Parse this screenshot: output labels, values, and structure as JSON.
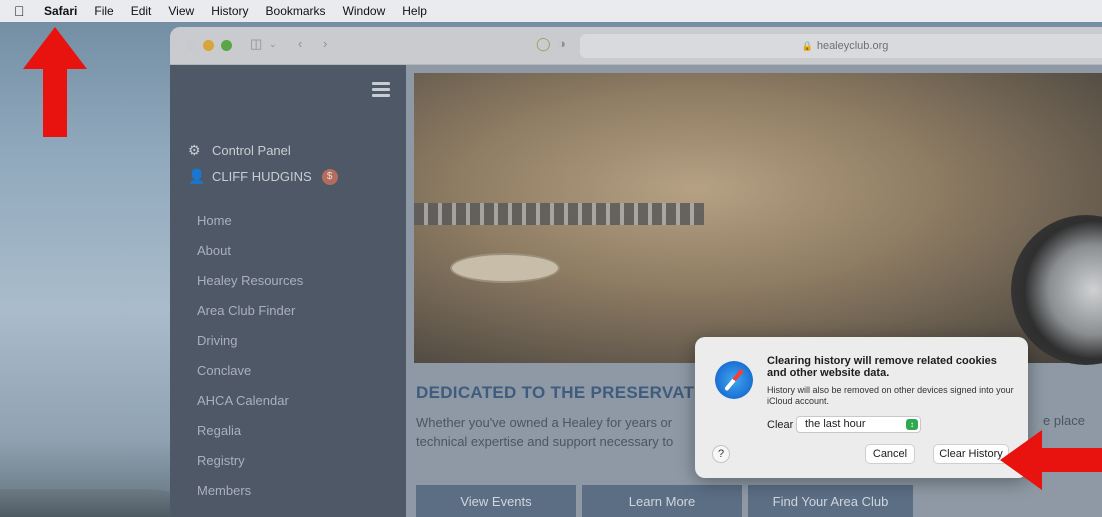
{
  "menubar": {
    "apple_icon": "apple-logo-icon",
    "items": [
      "Safari",
      "File",
      "Edit",
      "View",
      "History",
      "Bookmarks",
      "Window",
      "Help"
    ]
  },
  "browser": {
    "url": "healeyclub.org"
  },
  "sidebar": {
    "control_panel": "Control Panel",
    "user_name": "CLIFF HUDGINS",
    "badge": "$",
    "nav": [
      "Home",
      "About",
      "Healey Resources",
      "Area Club Finder",
      "Driving",
      "Conclave",
      "AHCA Calendar",
      "Regalia",
      "Registry",
      "Members"
    ]
  },
  "main": {
    "headline": "DEDICATED TO THE PRESERVATION AND EN",
    "paragraph": "Whether you've owned a Healey for years or technical expertise and support necessary to",
    "paragraph_right": "e place",
    "buttons": [
      "View Events",
      "Learn More",
      "Find Your Area Club"
    ]
  },
  "dialog": {
    "title": "Clearing history will remove related cookies and other website data.",
    "message": "History will also be removed on other devices signed into your iCloud account.",
    "clear_label": "Clear",
    "range_value": "the last hour",
    "help": "?",
    "cancel": "Cancel",
    "confirm": "Clear History"
  },
  "colors": {
    "annotation_arrow": "#e8130f",
    "sidebar": "#4f5867",
    "dialog_bg": "#ececec"
  }
}
